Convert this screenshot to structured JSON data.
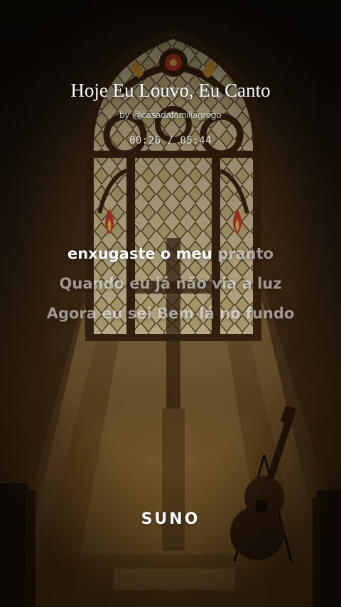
{
  "song": {
    "title": "Hoje Eu Louvo, Eu Canto",
    "artist": "by @casadafamiliagrego"
  },
  "player": {
    "current_time": "00:26",
    "separator": " / ",
    "total_time": "05:44"
  },
  "lyrics": {
    "active_line": {
      "sung": "enxugaste o meu ",
      "unsung": "pranto"
    },
    "next_lines": [
      "Quando eu já não via a luz",
      "Agora eu sei Bem lá no fundo"
    ]
  },
  "brand": {
    "logo_text": "SUNO"
  },
  "background": {
    "scene": "stained-glass-window-icon",
    "prop": "guitar-icon"
  },
  "colors": {
    "text_primary": "#ffffff",
    "text_dim": "rgba(255,255,255,0.55)",
    "warm_light": "#e6c878"
  }
}
